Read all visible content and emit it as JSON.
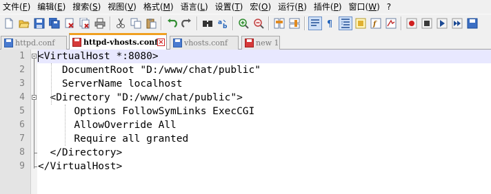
{
  "menu": [
    {
      "label": "文件(",
      "key": "F",
      "tail": ")"
    },
    {
      "label": "编辑(",
      "key": "E",
      "tail": ")"
    },
    {
      "label": "搜索(",
      "key": "S",
      "tail": ")"
    },
    {
      "label": "视图(",
      "key": "V",
      "tail": ")"
    },
    {
      "label": "格式(",
      "key": "M",
      "tail": ")"
    },
    {
      "label": "语言(",
      "key": "L",
      "tail": ")"
    },
    {
      "label": "设置(",
      "key": "T",
      "tail": ")"
    },
    {
      "label": "宏(",
      "key": "O",
      "tail": ")"
    },
    {
      "label": "运行(",
      "key": "R",
      "tail": ")"
    },
    {
      "label": "插件(",
      "key": "P",
      "tail": ")"
    },
    {
      "label": "窗口(",
      "key": "W",
      "tail": ")"
    },
    {
      "label": "?",
      "key": "",
      "tail": ""
    }
  ],
  "toolbar_icons": [
    "new-file-icon",
    "open-file-icon",
    "save-icon",
    "save-all-icon",
    "close-icon",
    "close-all-icon",
    "print-icon",
    "cut-icon",
    "copy-icon",
    "paste-icon",
    "undo-icon",
    "redo-icon",
    "find-icon",
    "replace-icon",
    "zoom-in-icon",
    "zoom-out-icon",
    "sync-vertical-icon",
    "sync-horizontal-icon",
    "word-wrap-icon",
    "show-all-chars-icon",
    "indent-guide-icon",
    "doc-map-icon",
    "function-list-icon",
    "folder-workspace-icon",
    "record-macro-icon",
    "stop-record-icon",
    "play-macro-icon",
    "run-macro-multiple-icon",
    "save-macro-icon"
  ],
  "tabs": [
    {
      "label": "httpd.conf",
      "active": false,
      "saved": true
    },
    {
      "label": "httpd-vhosts.conf",
      "active": true,
      "saved": false
    },
    {
      "label": "vhosts.conf",
      "active": false,
      "saved": true
    },
    {
      "label": "new 1",
      "active": false,
      "saved": false
    }
  ],
  "editor": {
    "lines": [
      {
        "num": "1",
        "text": "<VirtualHost *:8080>"
      },
      {
        "num": "2",
        "text": "    DocumentRoot \"D:/www/chat/public\""
      },
      {
        "num": "3",
        "text": "    ServerName localhost"
      },
      {
        "num": "4",
        "text": "  <Directory \"D:/www/chat/public\">"
      },
      {
        "num": "5",
        "text": "      Options FollowSymLinks ExecCGI"
      },
      {
        "num": "6",
        "text": "      AllowOverride All"
      },
      {
        "num": "7",
        "text": "      Require all granted"
      },
      {
        "num": "8",
        "text": "  </Directory>"
      },
      {
        "num": "9",
        "text": "</VirtualHost>"
      }
    ],
    "current_line": 1
  },
  "colors": {
    "active_tab_accent": "#f0a020",
    "current_line_bg": "#e8e8ff",
    "gutter_bg": "#e4e4e4",
    "close_button": "#d02020"
  }
}
